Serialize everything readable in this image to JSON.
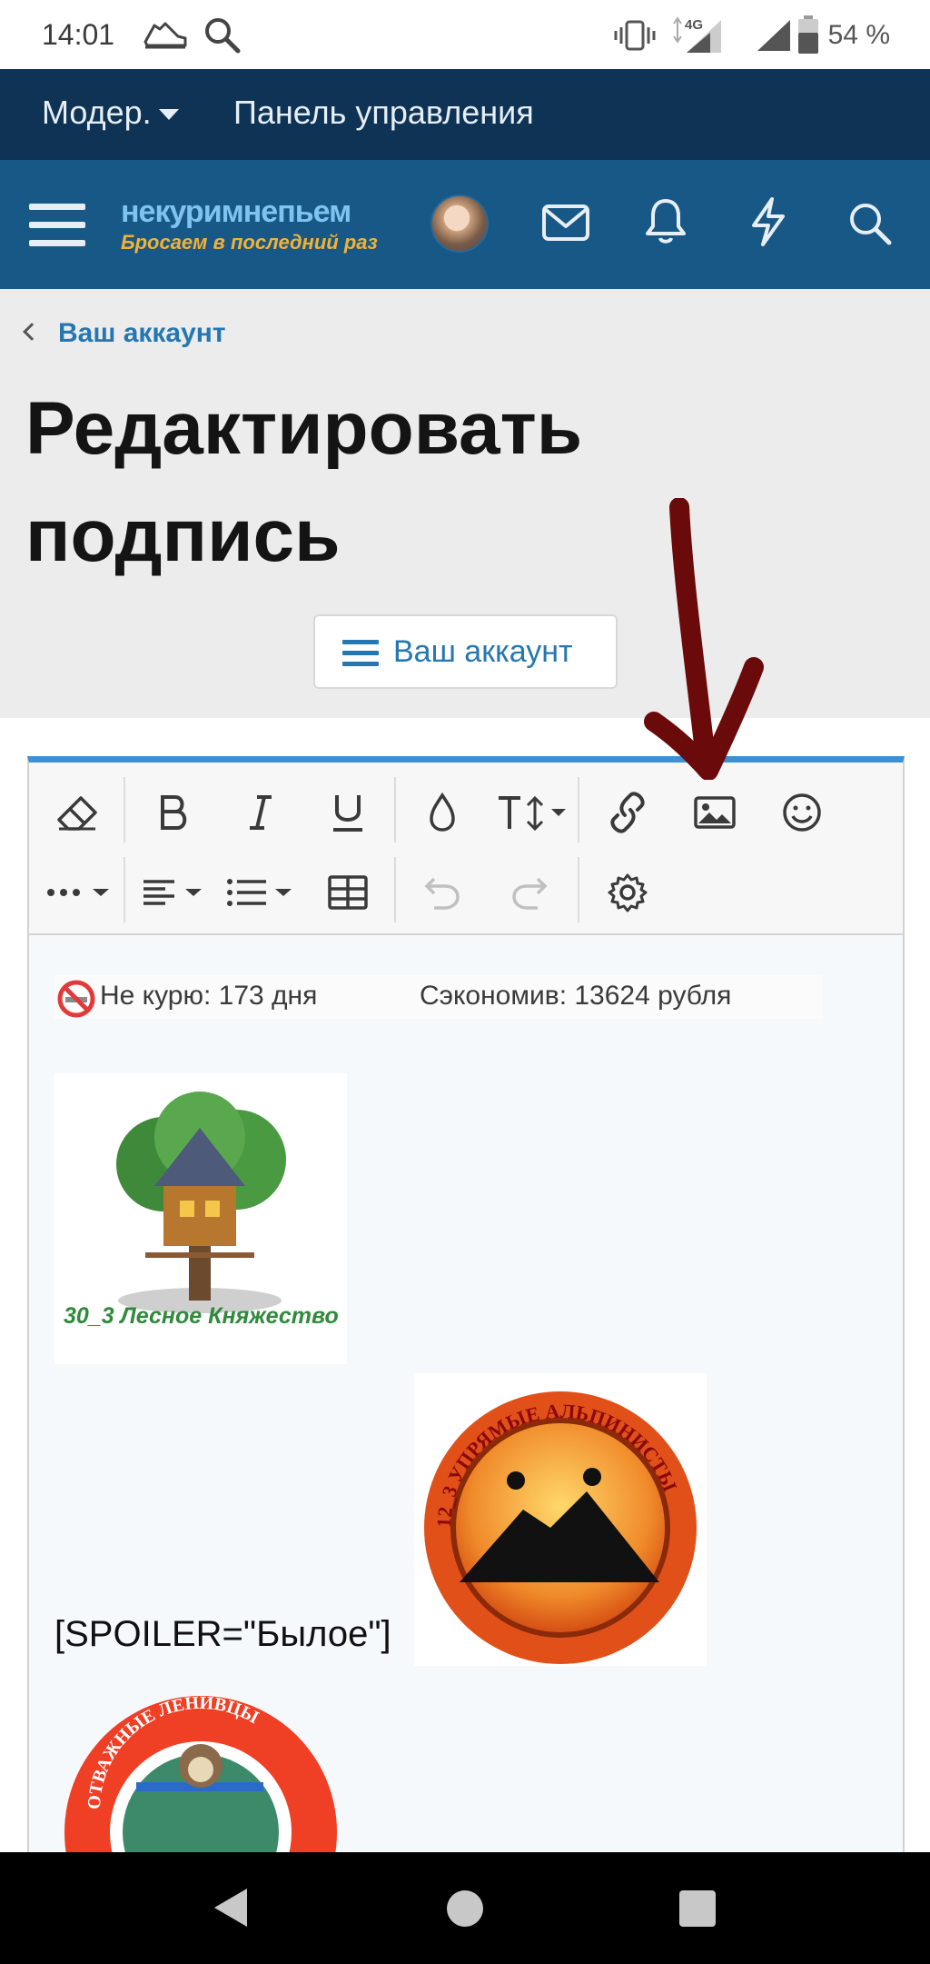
{
  "status_bar": {
    "time": "14:01",
    "network": "4G",
    "battery_percent": "54 %"
  },
  "mod_bar": {
    "moderator_label": "Модер.",
    "panel_label": "Панель управления"
  },
  "header": {
    "logo_top": "некуримнепьем",
    "logo_bottom": "Бросаем в последний раз"
  },
  "page": {
    "breadcrumb": "Ваш аккаунт",
    "title": "Редактировать подпись",
    "account_menu_button": "Ваш аккаунт"
  },
  "editor": {
    "toolbar_icons": [
      "eraser-icon",
      "bold-icon",
      "italic-icon",
      "underline-icon",
      "color-icon",
      "font-size-icon",
      "link-icon",
      "image-icon",
      "emoji-icon",
      "more-icon",
      "align-icon",
      "list-icon",
      "table-icon",
      "undo-icon",
      "redo-icon",
      "settings-icon"
    ],
    "content": {
      "counter_not_smoking": "Не курю: 173 дня",
      "counter_saved": "Сэкономив: 13624 рубля",
      "image1_caption": "30_3 Лесное Княжество",
      "image2_caption": "12_3 УПРЯМЫЕ АЛЬПИНИСТЫ",
      "spoiler_text": "[SPOILER=\"Былое\"]",
      "image3_caption": "ОТВАЖНЫЕ ЛЕНИВЦЫ"
    }
  },
  "colors": {
    "mod_bar_bg": "#0f3354",
    "header_bg": "#185886",
    "accent": "#2577b1",
    "editor_top_border": "#3d90d6",
    "annotation_arrow": "#6a0a0a"
  }
}
